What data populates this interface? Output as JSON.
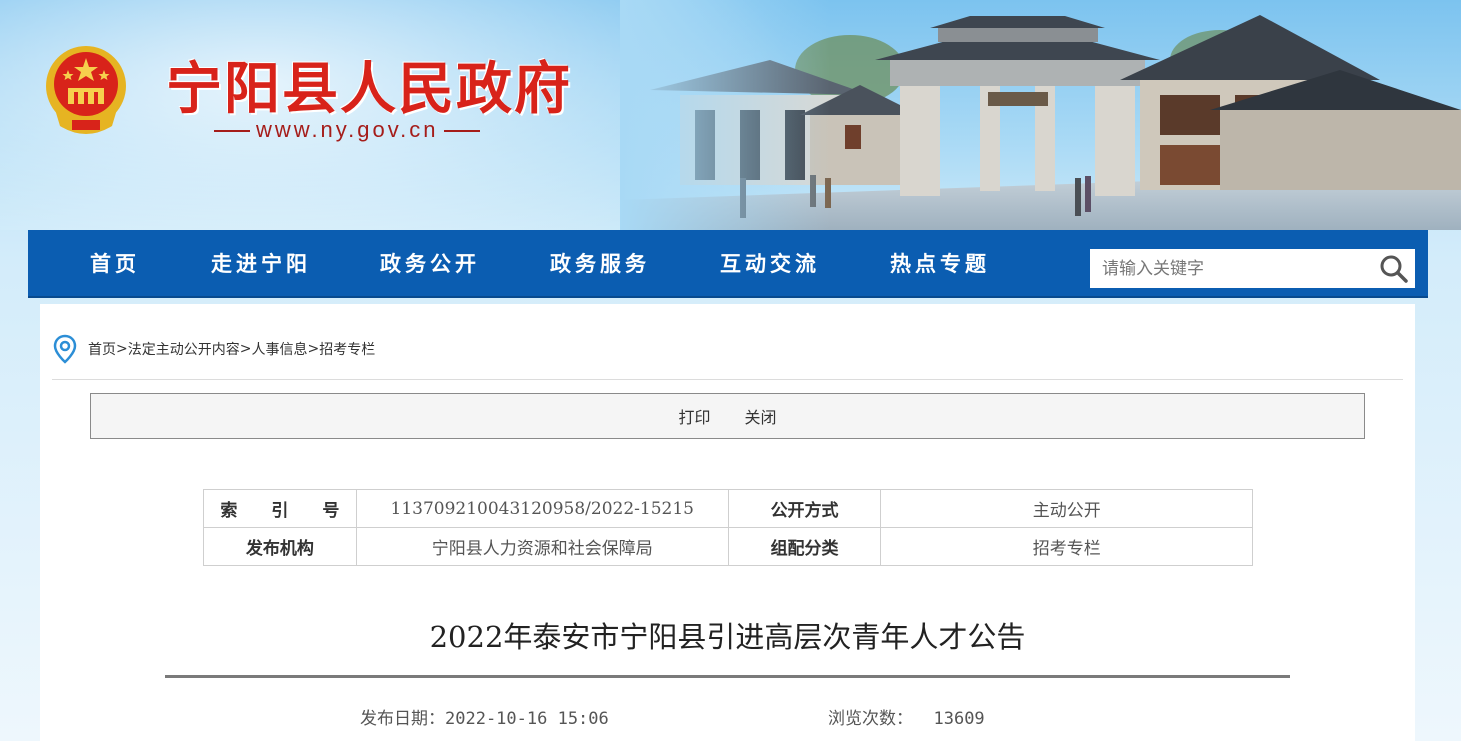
{
  "header": {
    "site_title": "宁阳县人民政府",
    "site_url": "www.ny.gov.cn"
  },
  "nav": {
    "items": [
      {
        "label": "首页"
      },
      {
        "label": "走进宁阳"
      },
      {
        "label": "政务公开"
      },
      {
        "label": "政务服务"
      },
      {
        "label": "互动交流"
      },
      {
        "label": "热点专题"
      }
    ],
    "search_placeholder": "请输入关键字"
  },
  "breadcrumb": {
    "items": [
      "首页",
      "法定主动公开内容",
      "人事信息",
      "招考专栏"
    ],
    "separator": ">"
  },
  "toolbar": {
    "print_label": "打印",
    "close_label": "关闭"
  },
  "meta_table": {
    "index_label": "索　　引　　号",
    "index_value": "113709210043120958/2022-15215",
    "disclosure_label": "公开方式",
    "disclosure_value": "主动公开",
    "publisher_label": "发布机构",
    "publisher_value": "宁阳县人力资源和社会保障局",
    "category_label": "组配分类",
    "category_value": "招考专栏"
  },
  "article": {
    "title": "2022年泰安市宁阳县引进高层次青年人才公告",
    "publish_date_label": "发布日期：",
    "publish_date": "2022-10-16 15:06",
    "views_label": "浏览次数：",
    "views": "13609"
  },
  "colors": {
    "nav_bg": "#0b5db1",
    "title_red": "#d8231a",
    "page_bg": "#d3ecfa"
  }
}
